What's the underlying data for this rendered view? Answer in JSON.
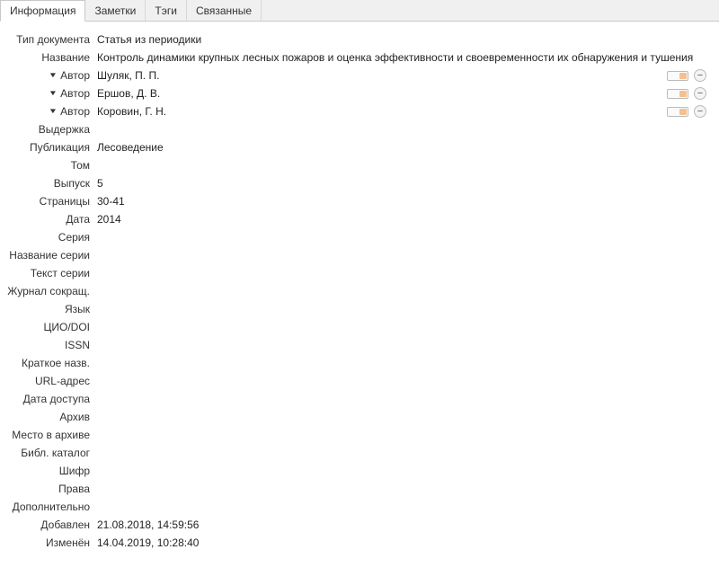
{
  "tabs": {
    "info": "Информация",
    "notes": "Заметки",
    "tags": "Тэги",
    "related": "Связанные"
  },
  "labels": {
    "doc_type": "Тип документа",
    "title": "Название",
    "author": "Автор",
    "abstract": "Выдержка",
    "publication": "Публикация",
    "volume": "Том",
    "issue": "Выпуск",
    "pages": "Страницы",
    "date": "Дата",
    "series": "Серия",
    "series_title": "Название серии",
    "series_text": "Текст серии",
    "journal_abbr": "Журнал сокращ.",
    "language": "Язык",
    "doi": "ЦИО/DOI",
    "issn": "ISSN",
    "short_title": "Краткое назв.",
    "url": "URL-адрес",
    "access_date": "Дата доступа",
    "archive": "Архив",
    "archive_loc": "Место в архиве",
    "library_catalog": "Библ. каталог",
    "call_number": "Шифр",
    "rights": "Права",
    "extra": "Дополнительно",
    "date_added": "Добавлен",
    "date_modified": "Изменён"
  },
  "values": {
    "doc_type": "Статья из периодики",
    "title": "Контроль динамики крупных лесных пожаров и оценка эффективности и своевременности их обнаружения и тушения",
    "authors": [
      "Шуляк, П. П.",
      "Ершов, Д. В.",
      "Коровин, Г. Н."
    ],
    "abstract": "",
    "publication": "Лесоведение",
    "volume": "",
    "issue": "5",
    "pages": "30-41",
    "date": "2014",
    "series": "",
    "series_title": "",
    "series_text": "",
    "journal_abbr": "",
    "language": "",
    "doi": "",
    "issn": "",
    "short_title": "",
    "url": "",
    "access_date": "",
    "archive": "",
    "archive_loc": "",
    "library_catalog": "",
    "call_number": "",
    "rights": "",
    "extra": "",
    "date_added": "21.08.2018, 14:59:56",
    "date_modified": "14.04.2019, 10:28:40"
  }
}
